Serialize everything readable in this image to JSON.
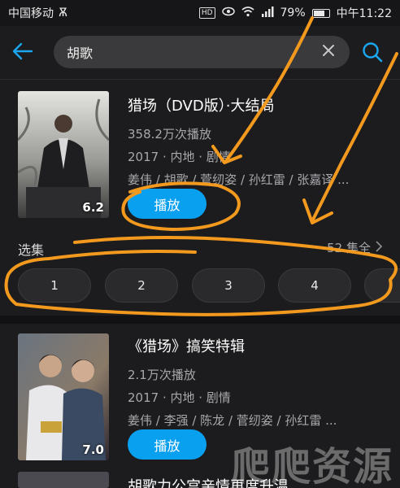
{
  "status_bar": {
    "carrier": "中国移动",
    "carrier_extra": "Ѫ",
    "hd_badge": "HD",
    "battery_percent": "79%",
    "battery_level": 0.79,
    "time": "中午11:22"
  },
  "search": {
    "query": "胡歌"
  },
  "results": [
    {
      "title": "猎场（DVD版）·大结局",
      "views": "358.2万次播放",
      "meta": "2017 · 内地 · 剧情",
      "cast": "姜伟 / 胡歌 / 菅纫姿 / 孙红雷 / 张嘉译 ...",
      "rating": "6.2",
      "play_label": "播放",
      "poster_colors": [
        "#d8d8d4",
        "#8c8c88",
        "#2a2a2c"
      ]
    },
    {
      "title": "《猎场》搞笑特辑",
      "views": "2.1万次播放",
      "meta": "2017 · 内地 · 剧情",
      "cast": "姜伟 / 李强 / 陈龙 / 菅纫姿 / 孙红雷 ...",
      "rating": "7.0",
      "play_label": "播放",
      "poster_colors": [
        "#5a6470",
        "#9a8870",
        "#3a3038"
      ]
    },
    {
      "title": "胡歌力公宫亲情再度升温",
      "views": "",
      "meta": "",
      "cast": "",
      "rating": "",
      "play_label": ""
    }
  ],
  "episodes": {
    "label": "选集",
    "all_label": "52 集全",
    "items": [
      "1",
      "2",
      "3",
      "4",
      ""
    ]
  },
  "watermark": "爬爬资源",
  "colors": {
    "accent": "#0aa0f0",
    "background": "#1c1c1e",
    "scribble": "#f39a1e"
  },
  "icons": {
    "back": "arrow-left-icon",
    "clear": "close-icon",
    "search": "search-icon",
    "chevron": "chevron-right-icon"
  }
}
